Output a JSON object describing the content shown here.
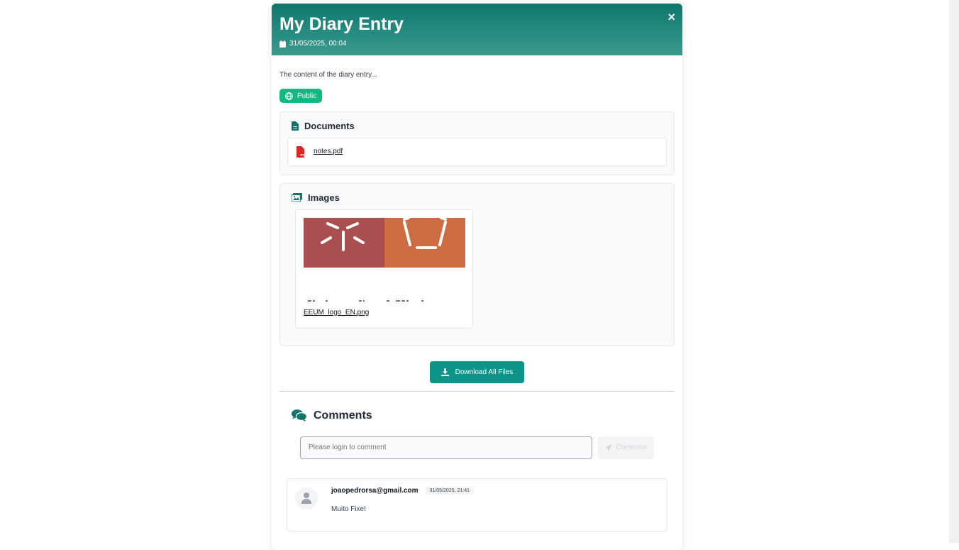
{
  "entry": {
    "title": "My Diary Entry",
    "date": "31/05/2025, 00:04",
    "content": "The content of the diary entry...",
    "visibility": "Public",
    "close_label": "×"
  },
  "documents": {
    "title": "Documents",
    "files": [
      {
        "name": "notes.pdf",
        "icon": "pdf-file-icon"
      }
    ]
  },
  "images": {
    "title": "Images",
    "files": [
      {
        "name": "EEUM_logo_EN.png"
      }
    ]
  },
  "download_all_label": "Download All Files",
  "comments": {
    "title": "Comments",
    "input_placeholder": "Please login to comment",
    "submit_label": "Comentar",
    "items": [
      {
        "author": "joaopedrorsa@gmail.com",
        "date": "31/05/2025, 21:41",
        "text": "Muito Fixe!"
      }
    ]
  },
  "colors": {
    "header_gradient_start": "#0f766e",
    "header_gradient_end": "#3a9b8d",
    "public_badge": "#10b981",
    "primary_button": "#0d9488",
    "pdf_red": "#dc2626",
    "logo_left": "#a94f4f",
    "logo_right": "#cd6c42"
  }
}
